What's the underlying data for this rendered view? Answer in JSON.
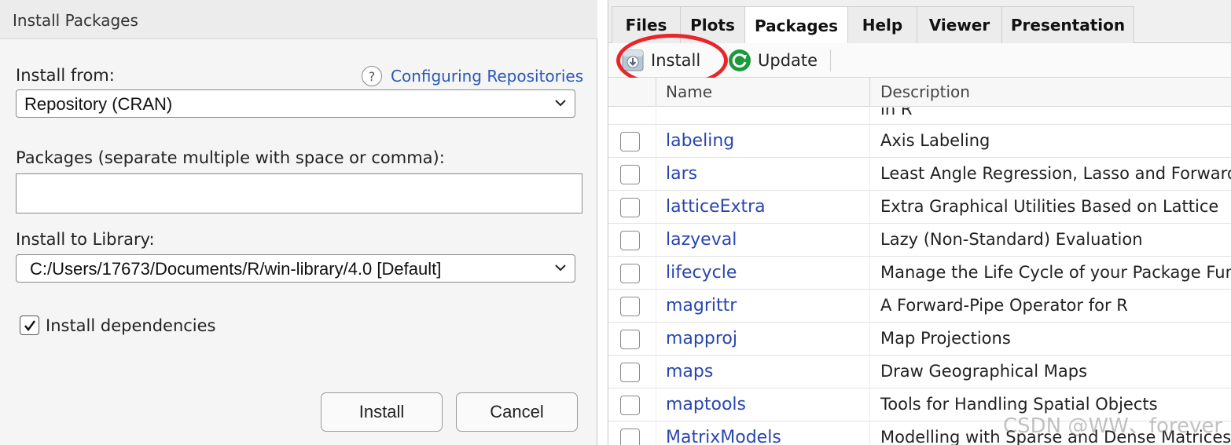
{
  "dialog": {
    "title": "Install Packages",
    "install_from_label": "Install from:",
    "help_icon_glyph": "?",
    "help_link": "Configuring Repositories",
    "repository_value": "Repository (CRAN)",
    "packages_label": "Packages (separate multiple with space or comma):",
    "packages_value": "",
    "library_label": "Install to Library:",
    "library_value": "C:/Users/17673/Documents/R/win-library/4.0 [Default]",
    "dependencies_label": "Install dependencies",
    "dependencies_checked": true,
    "install_button": "Install",
    "cancel_button": "Cancel"
  },
  "pane": {
    "tabs": [
      {
        "label": "Files",
        "active": false
      },
      {
        "label": "Plots",
        "active": false
      },
      {
        "label": "Packages",
        "active": true
      },
      {
        "label": "Help",
        "active": false
      },
      {
        "label": "Viewer",
        "active": false
      },
      {
        "label": "Presentation",
        "active": false
      }
    ],
    "toolbar": {
      "install_label": "Install",
      "update_label": "Update",
      "install_icon": "install-package-icon",
      "update_icon": "refresh-icon"
    },
    "highlight_color": "#e8262a",
    "columns": {
      "name": "Name",
      "description": "Description"
    },
    "partial_row_desc": "in R",
    "rows": [
      {
        "name": "labeling",
        "description": "Axis Labeling"
      },
      {
        "name": "lars",
        "description": "Least Angle Regression, Lasso and Forward"
      },
      {
        "name": "latticeExtra",
        "description": "Extra Graphical Utilities Based on Lattice"
      },
      {
        "name": "lazyeval",
        "description": "Lazy (Non-Standard) Evaluation"
      },
      {
        "name": "lifecycle",
        "description": "Manage the Life Cycle of your Package Fun"
      },
      {
        "name": "magrittr",
        "description": "A Forward-Pipe Operator for R"
      },
      {
        "name": "mapproj",
        "description": "Map Projections"
      },
      {
        "name": "maps",
        "description": "Draw Geographical Maps"
      },
      {
        "name": "maptools",
        "description": "Tools for Handling Spatial Objects"
      },
      {
        "name": "MatrixModels",
        "description": "Modelling with Sparse and Dense Matrices"
      }
    ]
  },
  "watermark": "CSDN @WW、forever",
  "colors": {
    "link": "#2958b8",
    "package_name": "#2946b0",
    "update_green": "#1a9a3a"
  }
}
